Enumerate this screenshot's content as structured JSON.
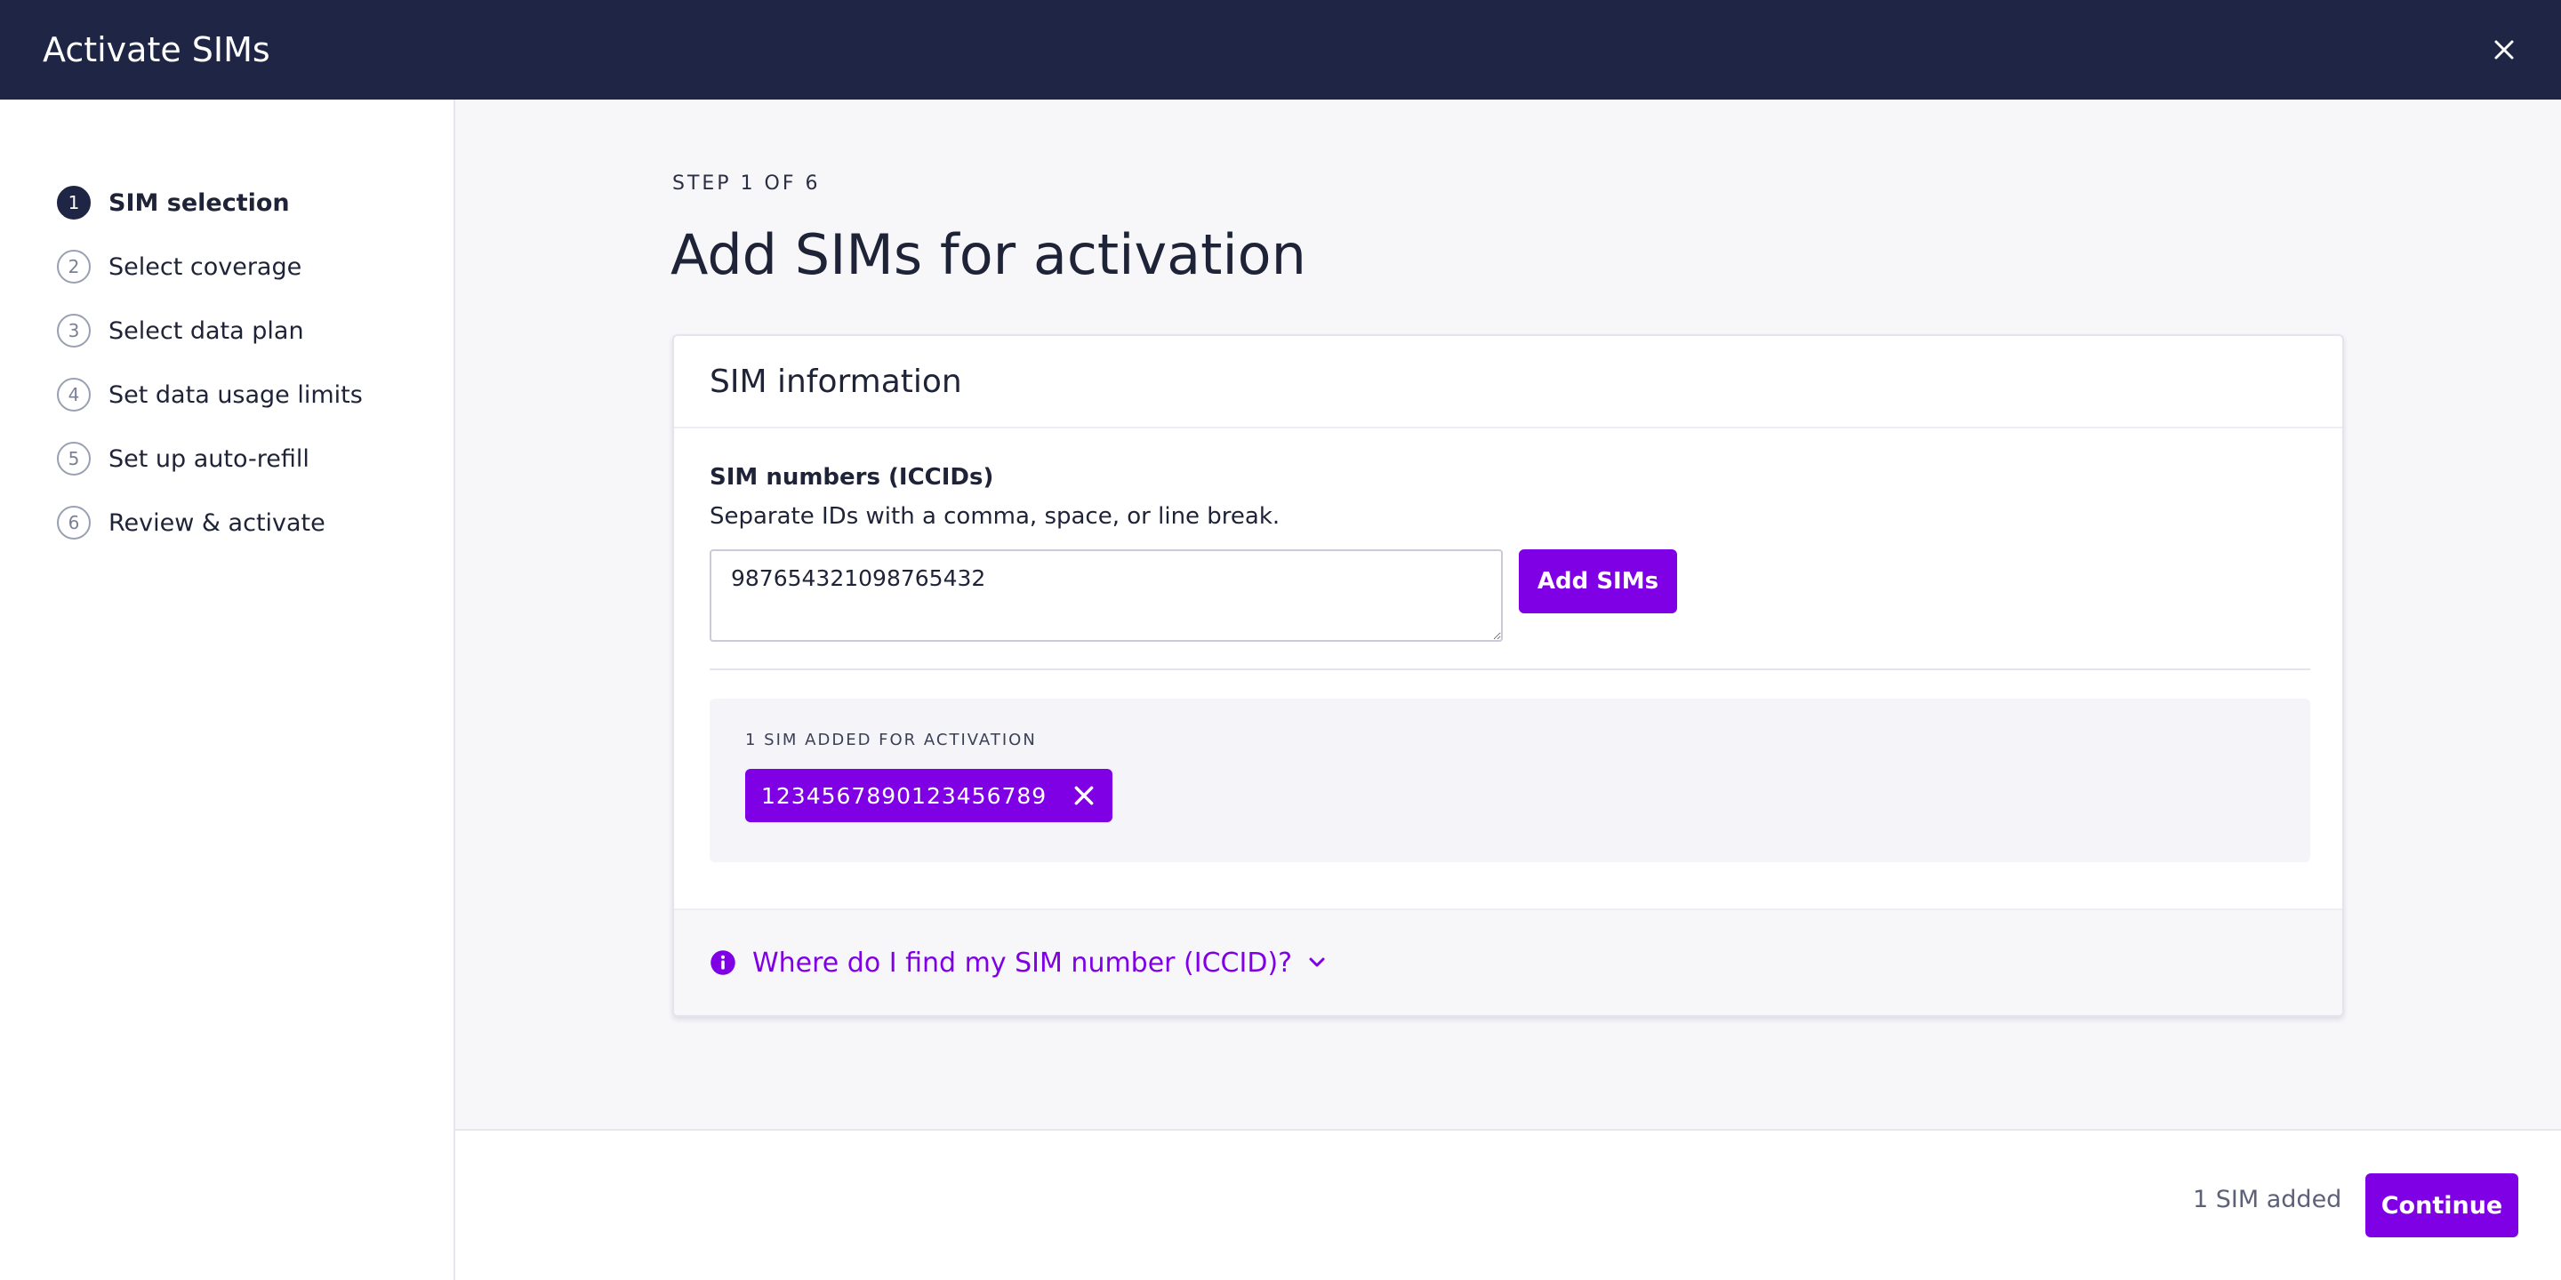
{
  "header": {
    "title": "Activate SIMs",
    "close_icon": "close-icon"
  },
  "sidebar": {
    "steps": [
      {
        "num": "1",
        "label": "SIM selection",
        "active": true
      },
      {
        "num": "2",
        "label": "Select coverage",
        "active": false
      },
      {
        "num": "3",
        "label": "Select data plan",
        "active": false
      },
      {
        "num": "4",
        "label": "Set data usage limits",
        "active": false
      },
      {
        "num": "5",
        "label": "Set up auto-refill",
        "active": false
      },
      {
        "num": "6",
        "label": "Review & activate",
        "active": false
      }
    ]
  },
  "main": {
    "step_indicator": "STEP 1 OF 6",
    "title": "Add SIMs for activation",
    "card": {
      "title": "SIM information",
      "field_label": "SIM numbers (ICCIDs)",
      "field_help": "Separate IDs with a comma, space, or line break.",
      "input_value": "987654321098765432",
      "add_button": "Add SIMs",
      "added_label": "1 SIM ADDED FOR ACTIVATION",
      "added_sims": [
        "1234567890123456789"
      ],
      "help_link": "Where do I find my SIM number (ICCID)?"
    }
  },
  "footer": {
    "count_text": "1 SIM added",
    "continue_button": "Continue"
  },
  "colors": {
    "navy": "#1e2545",
    "accent": "#8000e6",
    "background": "#f7f7fa"
  }
}
